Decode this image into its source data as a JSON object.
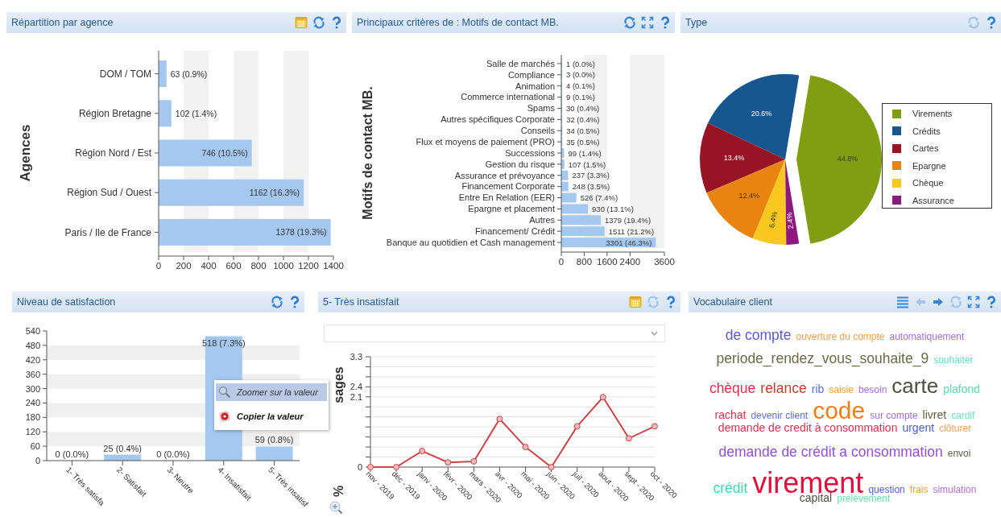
{
  "rows": [
    {
      "panels": [
        {
          "title": "Répartition par agence",
          "tools": [
            {
              "kind": "calendar",
              "disabled": false
            },
            {
              "kind": "refresh",
              "disabled": false
            },
            {
              "kind": "help",
              "disabled": false
            }
          ],
          "chart_data": {
            "type": "bar",
            "orientation": "horizontal",
            "ylabel": "Agences",
            "categories": [
              "DOM / TOM",
              "Région Bretagne",
              "Région Nord / Est",
              "Région Sud / Ouest",
              "Paris / Ile de France"
            ],
            "values": [
              63,
              102,
              746,
              1162,
              1378
            ],
            "value_labels": [
              "63 (0.9%)",
              "102 (1.4%)",
              "746 (10.5%)",
              "1162 (16.3%)",
              "1378 (19.3%)"
            ],
            "xlim": [
              0,
              1400
            ],
            "xticks": [
              0,
              200,
              400,
              600,
              800,
              1000,
              1200,
              1400
            ]
          }
        },
        {
          "title": "Principaux critères de : Motifs de contact MB.",
          "tools": [
            {
              "kind": "refresh",
              "disabled": false
            },
            {
              "kind": "expand",
              "disabled": false
            },
            {
              "kind": "help",
              "disabled": false
            }
          ],
          "chart_data": {
            "type": "bar",
            "orientation": "horizontal",
            "ylabel": "Motifs de contact MB.",
            "categories": [
              "Salle de marchés",
              "Compliance",
              "Animation",
              "Commerce international",
              "Spams",
              "Autres spécifiques Corporate",
              "Conseils",
              "Flux et moyens de paiement (PRO)",
              "Successions",
              "Gestion du risque",
              "Assurance et prévoyance",
              "Financement Corporate",
              "Entre En Relation (EER)",
              "Epargne et placement",
              "Autres",
              "Financement/ Crédit",
              "Banque au quotidien et Cash management"
            ],
            "values": [
              1,
              3,
              4,
              9,
              30,
              32,
              34,
              35,
              99,
              107,
              237,
              248,
              526,
              930,
              1379,
              1511,
              3301
            ],
            "value_labels": [
              "1 (0.0%)",
              "3 (0.0%)",
              "4 (0.1%)",
              "9 (0.1%)",
              "30 (0.4%)",
              "32 (0.4%)",
              "34 (0.5%)",
              "35 (0.5%)",
              "99 (1.4%)",
              "107 (1.5%)",
              "237 (3.3%)",
              "248 (3.5%)",
              "526 (7.4%)",
              "930 (13.1%)",
              "1379 (19.4%)",
              "1511 (21.2%)",
              "3301 (46.3%)"
            ],
            "xlim": [
              0,
              3600
            ],
            "xticks": [
              0,
              800,
              1600,
              2400,
              3600
            ]
          }
        },
        {
          "title": "Type",
          "tools": [
            {
              "kind": "refresh",
              "disabled": true
            },
            {
              "kind": "help",
              "disabled": false
            }
          ],
          "legend": [
            {
              "color": "#7f9e12",
              "exploded": true
            },
            {
              "color": "#17568f",
              "exploded": false
            },
            {
              "color": "#961424",
              "exploded": false
            },
            {
              "color": "#e88410",
              "exploded": false
            },
            {
              "color": "#f8c820",
              "exploded": false
            },
            {
              "color": "#8c1880",
              "exploded": false
            }
          ],
          "chart_data": {
            "type": "pie",
            "categories": [
              "Virements",
              "Crédits",
              "Cartes",
              "Epargne",
              "Chèque",
              "Assurance"
            ],
            "values": [
              44.8,
              20.6,
              13.4,
              12.4,
              6.4,
              2.4
            ],
            "value_labels": [
              "44.8%",
              "20.6%",
              "13.4%",
              "12.4%",
              "6.4%",
              "2.4%"
            ]
          }
        }
      ]
    },
    {
      "panels": [
        {
          "title": "Niveau de satisfaction",
          "tools": [
            {
              "kind": "refresh",
              "disabled": false
            },
            {
              "kind": "help",
              "disabled": false
            }
          ],
          "chart_data": {
            "type": "bar",
            "orientation": "vertical",
            "categories": [
              "1- Très satisfa",
              "2- Satisfait",
              "3- Neutre",
              "4- Insatisfait",
              "5- Très insatisf"
            ],
            "values": [
              0,
              25,
              0,
              518,
              59
            ],
            "value_labels": [
              "0 (0.0%)",
              "25 (0.4%)",
              "0 (0.0%)",
              "518 (7.3%)",
              "59 (0.8%)"
            ],
            "ylim": [
              0,
              540
            ],
            "yticks": [
              0,
              60,
              120,
              180,
              240,
              300,
              360,
              420,
              480,
              540
            ]
          }
        },
        {
          "title": "5- Très insatisfait",
          "tools": [
            {
              "kind": "calendar",
              "disabled": false
            },
            {
              "kind": "refresh",
              "disabled": true
            },
            {
              "kind": "help",
              "disabled": false
            }
          ],
          "dropdown": {
            "expanded": false
          },
          "ylabel_parts": [
            "sages",
            "%"
          ],
          "chart_data": {
            "type": "line",
            "x": [
              "nov - 2019",
              "déc - 2019",
              "janv - 2020",
              "févr - 2020",
              "mars - 2020",
              "avr - 2020",
              "mai - 2020",
              "juin - 2020",
              "juil - 2020",
              "aout - 2020",
              "sept - 2020",
              "oct - 2020"
            ],
            "series": [
              {
                "color": "#c8464a",
                "marker": "o",
                "values": [
                  0,
                  0,
                  0.48,
                  0.14,
                  0.17,
                  1.44,
                  0.6,
                  0,
                  1.22,
                  2.09,
                  0.86,
                  1.22
                ]
              }
            ],
            "ylim": [
              0,
              3.3
            ],
            "yticks": [
              0,
              2.1,
              2.4,
              3.3
            ]
          }
        },
        {
          "title": "Vocabulaire client",
          "tools": [
            {
              "kind": "list",
              "disabled": false
            },
            {
              "kind": "back",
              "disabled": true
            },
            {
              "kind": "forward",
              "disabled": false
            },
            {
              "kind": "refresh",
              "disabled": true
            },
            {
              "kind": "expand",
              "disabled": false
            },
            {
              "kind": "help",
              "disabled": false
            }
          ],
          "lines": [
            [
              {
                "text": "de compte",
                "kind": "big",
                "color": "#5a5ad8"
              },
              {
                "text": "ouverture du compte",
                "kind": "small",
                "color": "#f0a050"
              },
              {
                "text": "automatiquement",
                "kind": "small",
                "color": "#a070e0"
              }
            ],
            [
              {
                "text": "periode_rendez_vous_souhaite_9",
                "kind": "big",
                "color": "#6a6a48"
              },
              {
                "text": "souhaiter",
                "kind": "small",
                "color": "#70d8c8"
              }
            ],
            [
              {
                "text": "chèque",
                "kind": "big",
                "color": "#e03050"
              },
              {
                "text": "relance",
                "kind": "big",
                "color": "#c04030"
              },
              {
                "text": "rib",
                "kind": "medium",
                "color": "#6070e0"
              },
              {
                "text": "saisie",
                "kind": "small",
                "color": "#f0a040"
              },
              {
                "text": "besoin",
                "kind": "small",
                "color": "#a070e0"
              },
              {
                "text": "carte",
                "kind": "large",
                "color": "#505040"
              },
              {
                "text": "plafond",
                "kind": "medium",
                "color": "#60d8b0"
              }
            ],
            [
              {
                "text": "rachat",
                "kind": "medium",
                "color": "#e03050"
              },
              {
                "text": "devenir client",
                "kind": "small",
                "color": "#6070e0"
              },
              {
                "text": "code",
                "kind": "xlarge",
                "color": "#f08010"
              },
              {
                "text": "sur compte",
                "kind": "small",
                "color": "#a070e0"
              },
              {
                "text": "livret",
                "kind": "medium",
                "color": "#606040"
              },
              {
                "text": "cardif",
                "kind": "small",
                "color": "#70e0c0"
              }
            ],
            [
              {
                "text": "demande de credit à consommation",
                "kind": "medium",
                "color": "#e03050"
              },
              {
                "text": "urgent",
                "kind": "medium",
                "color": "#5060d0"
              },
              {
                "text": "clôturer",
                "kind": "small",
                "color": "#f0a060"
              }
            ],
            [
              {
                "text": "demande de crédit a consommation",
                "kind": "big",
                "color": "#9050e0"
              },
              {
                "text": "envoi",
                "kind": "small",
                "color": "#606050"
              }
            ],
            [
              {
                "text": "crédit",
                "kind": "big",
                "color": "#40d8b0"
              },
              {
                "text": "virement",
                "kind": "huge",
                "color": "#e0103a"
              },
              {
                "text": "question",
                "kind": "small",
                "color": "#5060d8"
              },
              {
                "text": "frais",
                "kind": "small",
                "color": "#f0a040"
              },
              {
                "text": "simulation",
                "kind": "small",
                "color": "#b070e0"
              }
            ],
            [
              {
                "text": "capital",
                "kind": "medium",
                "color": "#505040"
              },
              {
                "text": "prélèvement",
                "kind": "small",
                "color": "#70e0b0"
              }
            ]
          ]
        }
      ]
    }
  ],
  "context_menu": {
    "items": [
      {
        "kind": "zoom",
        "label": "Zoomer sur la valeur",
        "selected": true
      },
      {
        "kind": "copy",
        "label": "Copier la valeur",
        "selected": false
      }
    ]
  }
}
